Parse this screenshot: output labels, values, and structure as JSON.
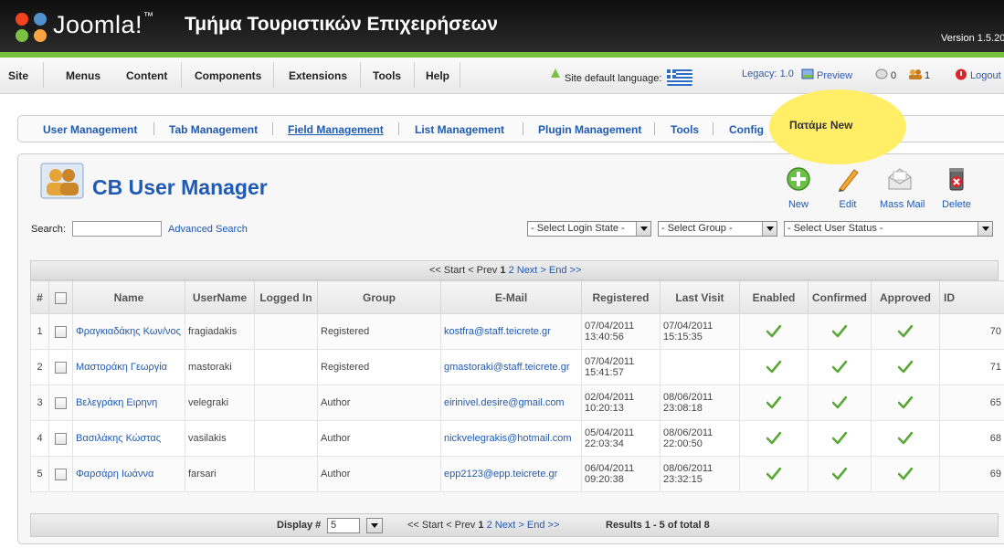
{
  "header": {
    "logo_text": "Joomla!",
    "logo_tm": "™",
    "site_name": "Τμήμα Τουριστικών Επιχειρήσεων",
    "version": "Version 1.5.20"
  },
  "menubar": {
    "items": [
      "Site",
      "Menus",
      "Content",
      "Components",
      "Extensions",
      "Tools",
      "Help"
    ],
    "language_label": "Site default language:",
    "legacy": "Legacy: 1.0",
    "preview": "Preview",
    "messages": "0",
    "users_online": "1",
    "logout": "Logout"
  },
  "submenu": {
    "items": [
      "User Management",
      "Tab Management",
      "Field Management",
      "List Management",
      "Plugin Management",
      "Tools",
      "Config"
    ],
    "active": "Field Management"
  },
  "callout": {
    "text": "Πατάμε New"
  },
  "page": {
    "title": "CB User Manager"
  },
  "toolbar": {
    "new": "New",
    "edit": "Edit",
    "mass_mail": "Mass Mail",
    "delete": "Delete"
  },
  "filters": {
    "search_label": "Search:",
    "search_value": "",
    "advanced_search": "Advanced Search",
    "login_state": "- Select Login State -",
    "group": "- Select Group -",
    "user_status": "- Select User Status -"
  },
  "pagination_top": {
    "start": "<< Start",
    "prev": "< Prev",
    "current": "1",
    "next_page": "2",
    "next": "Next >",
    "end": "End >>"
  },
  "table": {
    "headers": [
      "#",
      "",
      "Name",
      "UserName",
      "Logged In",
      "Group",
      "E-Mail",
      "Registered",
      "Last Visit",
      "Enabled",
      "Confirmed",
      "Approved",
      "ID"
    ],
    "rows": [
      {
        "num": "1",
        "name": "Φραγκιαδάκης Κων/νος",
        "username": "fragiadakis",
        "logged_in": "",
        "group": "Registered",
        "email": "kostfra@staff.teicrete.gr",
        "registered_date": "07/04/2011",
        "registered_time": "13:40:56",
        "last_date": "07/04/2011",
        "last_time": "15:15:35",
        "id": "70"
      },
      {
        "num": "2",
        "name": "Μαστοράκη Γεωργία",
        "username": "mastoraki",
        "logged_in": "",
        "group": "Registered",
        "email": "gmastoraki@staff.teicrete.gr",
        "registered_date": "07/04/2011",
        "registered_time": "15:41:57",
        "last_date": "",
        "last_time": "",
        "id": "71"
      },
      {
        "num": "3",
        "name": "Βελεγράκη Ειρηνη",
        "username": "velegraki",
        "logged_in": "",
        "group": "Author",
        "email": "eirinivel.desire@gmail.com",
        "registered_date": "02/04/2011",
        "registered_time": "10:20:13",
        "last_date": "08/06/2011",
        "last_time": "23:08:18",
        "id": "65"
      },
      {
        "num": "4",
        "name": "Βασιλάκης Κώστας",
        "username": "vasilakis",
        "logged_in": "",
        "group": "Author",
        "email": "nickvelegrakis@hotmail.com",
        "registered_date": "05/04/2011",
        "registered_time": "22:03:34",
        "last_date": "08/06/2011",
        "last_time": "22:00:50",
        "id": "68"
      },
      {
        "num": "5",
        "name": "Φαρσάρη Ιωάννα",
        "username": "farsari",
        "logged_in": "",
        "group": "Author",
        "email": "epp2123@epp.teicrete.gr",
        "registered_date": "06/04/2011",
        "registered_time": "09:20:38",
        "last_date": "08/06/2011",
        "last_time": "23:32:15",
        "id": "69"
      }
    ]
  },
  "footer": {
    "display_label": "Display #",
    "display_value": "5",
    "start": "<< Start",
    "prev": "< Prev",
    "current": "1",
    "next_page": "2",
    "next": "Next >",
    "end": "End >>",
    "results": "Results 1 - 5 of total 8"
  },
  "colors": {
    "link": "#1f5ab3",
    "accent_green": "#7ac143",
    "callout": "#ffee66"
  }
}
